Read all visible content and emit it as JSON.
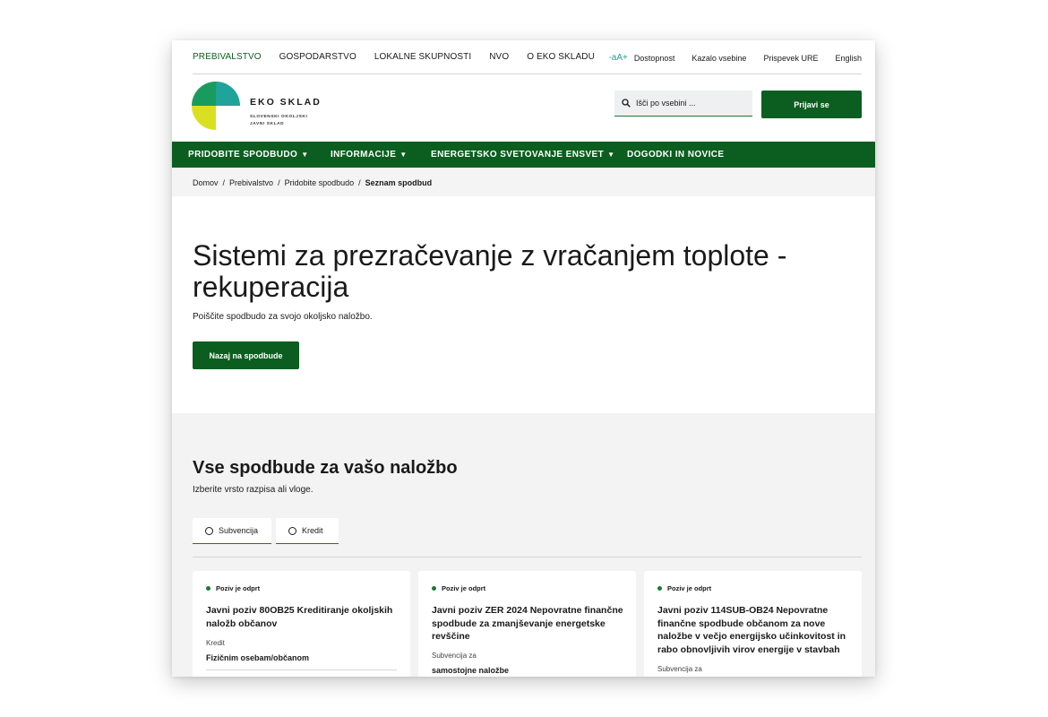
{
  "topnav": {
    "items": [
      "PREBIVALSTVO",
      "GOSPODARSTVO",
      "LOKALNE SKUPNOSTI",
      "NVO",
      "O EKO SKLADU"
    ],
    "active": "PREBIVALSTVO"
  },
  "utility": {
    "font_size": "-aA+",
    "accessibility": "Dostopnost",
    "sitemap": "Kazalo vsebine",
    "ure": "Prispevek URE",
    "language": "English"
  },
  "brand": {
    "name": "EKO SKLAD",
    "sub_line1": "SLOVENSKI OKOLJSKI",
    "sub_line2": "JAVNI SKLAD"
  },
  "search": {
    "placeholder": "Išči po vsebini ..."
  },
  "login": {
    "label": "Prijavi se"
  },
  "mainnav": {
    "items": [
      {
        "label": "PRIDOBITE SPODBUDO",
        "caret": "▼"
      },
      {
        "label": "INFORMACIJE",
        "caret": "▼"
      },
      {
        "label": "ENERGETSKO SVETOVANJE ENSVET",
        "caret": "▼"
      },
      {
        "label": "DOGODKI IN NOVICE",
        "caret": ""
      }
    ]
  },
  "breadcrumb": [
    "Domov",
    "Prebivalstvo",
    "Pridobite spodbudo",
    "Seznam spodbud"
  ],
  "breadcrumb_sep": "/",
  "hero": {
    "title": "Sistemi za prezračevanje z vračanjem toplote - rekuperacija",
    "subtitle": "Poiščite spodbudo za svojo okoljsko naložbo.",
    "back_label": "Nazaj na spodbude"
  },
  "section": {
    "title": "Vse spodbude za vašo naložbo",
    "subtitle": "Izberite vrsto razpisa ali vloge.",
    "filters": [
      "Subvencija",
      "Kredit"
    ]
  },
  "cards": [
    {
      "status": "Poziv je odprt",
      "title": "Javni poziv 80OB25 Kreditiranje okoljskih naložb občanov",
      "type": "Kredit",
      "target": "Fizičnim osebam/občanom"
    },
    {
      "status": "Poziv je odprt",
      "title": "Javni poziv ZER 2024 Nepovratne finančne spodbude za zmanjševanje energetske revščine",
      "type": "Subvencija za",
      "target": "samostojne naložbe"
    },
    {
      "status": "Poziv je odprt",
      "title": "Javni poziv 114SUB-OB24 Nepovratne finančne spodbude občanom za nove naložbe v večjo energijsko učinkovitost in rabo obnovljivih virov energije v stavbah",
      "type": "Subvencija za",
      "target": ""
    }
  ],
  "colors": {
    "brand_green": "#0b5e1f",
    "accent_teal": "#2a9d8f",
    "logo_green": "#1a9b5e",
    "logo_teal": "#1fa39a",
    "logo_yellow": "#d9e021"
  }
}
